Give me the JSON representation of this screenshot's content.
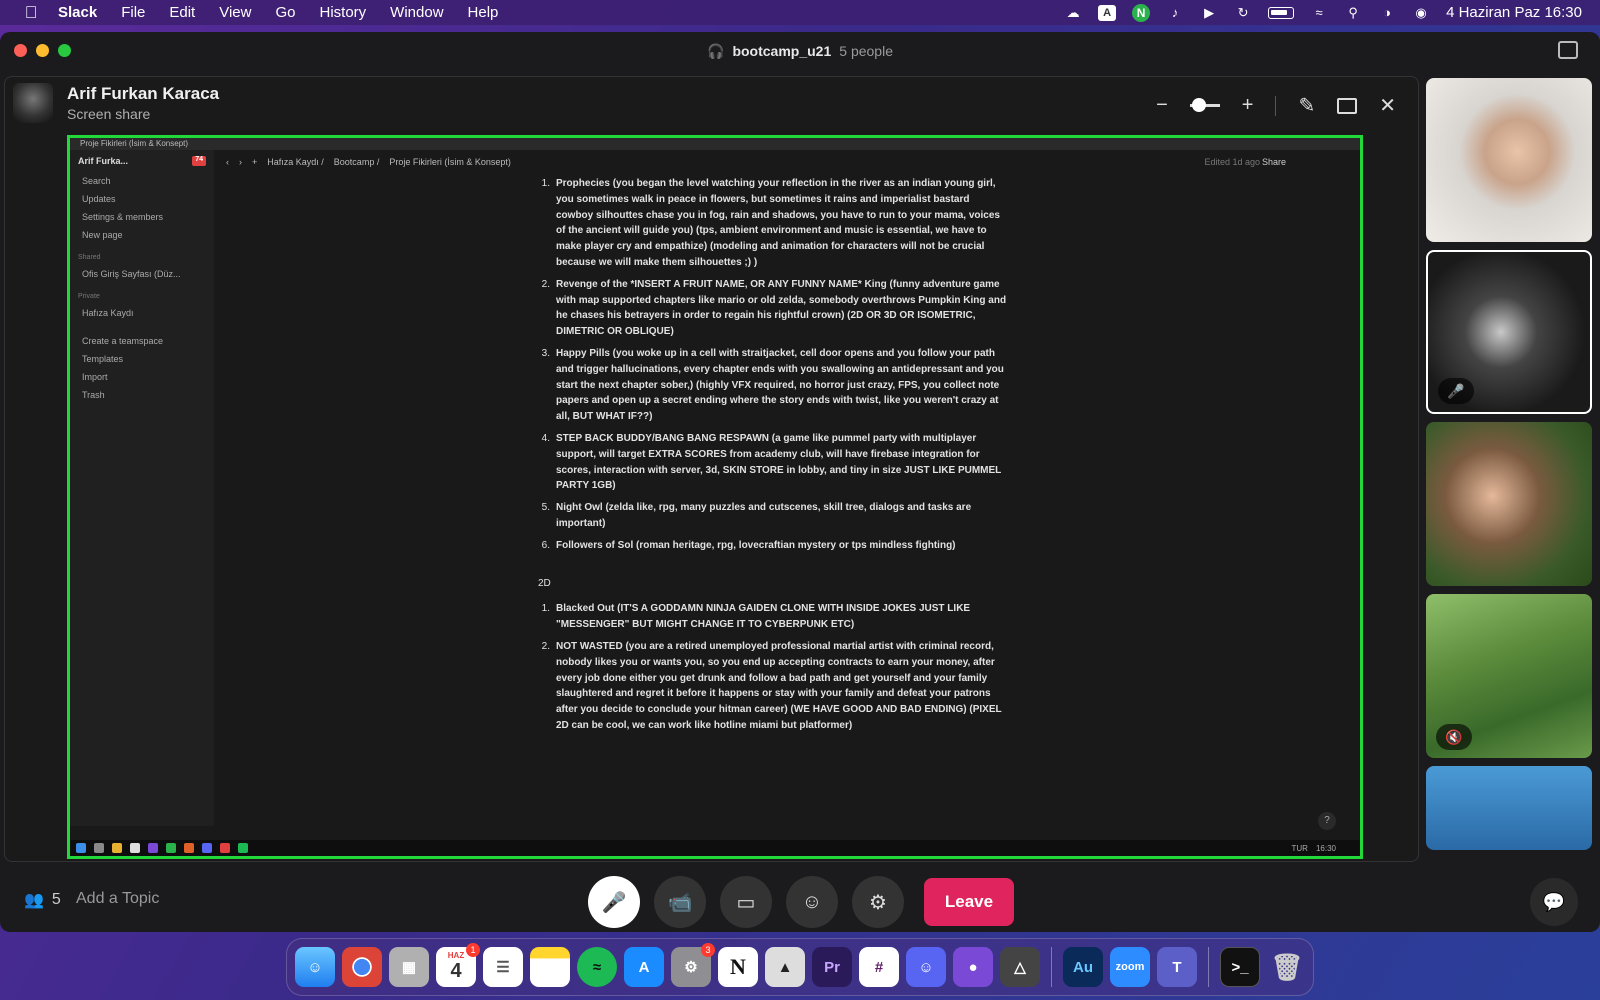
{
  "menubar": {
    "app_name": "Slack",
    "items": [
      "File",
      "Edit",
      "View",
      "Go",
      "History",
      "Window",
      "Help"
    ],
    "date_time": "4 Haziran Paz  16:30"
  },
  "window": {
    "channel": "bootcamp_u21",
    "people_count": "5 people"
  },
  "presenter": {
    "name": "Arif Furkan Karaca",
    "subtitle": "Screen share"
  },
  "shared_screen": {
    "window_title": "Proje Fikirleri (İsim & Konsept)",
    "sidebar": {
      "workspace": "Arif Furka...",
      "badge": "74",
      "items": [
        "Search",
        "Updates",
        "Settings & members",
        "New page"
      ],
      "shared_label": "Shared",
      "shared_items": [
        "Ofis Giriş Sayfası (Düz..."
      ],
      "private_label": "Private",
      "private_items": [
        "Hafıza Kaydı"
      ],
      "footer_items": [
        "Create a teamspace",
        "Templates",
        "Import",
        "Trash"
      ]
    },
    "breadcrumbs": [
      "Hafıza Kaydı /",
      "Bootcamp /",
      "Proje Fikirleri (İsim & Konsept)"
    ],
    "edited": "Edited 1d ago",
    "share_label": "Share",
    "list_3d": [
      {
        "num": "1.",
        "text": "Prophecies (you began the level watching your reflection in the river as an indian young girl, you sometimes walk in peace in flowers, but sometimes it rains and imperialist bastard cowboy silhouttes chase you in fog, rain and shadows, you have to run to your mama, voices of the ancient will guide you) (tps, ambient environment and music is essential, we have to make player cry and empathize) (modeling and animation for characters will not be crucial because we will make them silhouettes ;) )"
      },
      {
        "num": "2.",
        "text": "Revenge of the *INSERT A FRUIT NAME, OR ANY FUNNY NAME* King (funny adventure game with map supported chapters like mario or old zelda, somebody overthrows Pumpkin King and he chases his betrayers in order to regain his rightful crown) (2D OR 3D OR ISOMETRIC, DIMETRIC OR OBLIQUE)"
      },
      {
        "num": "3.",
        "text": "Happy Pills (you woke up in a cell with straitjacket, cell door opens and you follow your path and trigger hallucinations, every chapter ends with you swallowing an antidepressant and you start the next chapter sober,) (highly VFX required, no horror just crazy, FPS, you collect note papers and open up a secret ending where the story ends with twist, like you weren't crazy at all, BUT WHAT IF??)"
      },
      {
        "num": "4.",
        "text": "STEP BACK BUDDY/BANG BANG RESPAWN (a game like pummel party with multiplayer support, will target EXTRA SCORES from academy club, will have firebase integration for scores, interaction with server, 3d, SKIN STORE in lobby, and tiny in size JUST LIKE PUMMEL PARTY 1GB)"
      },
      {
        "num": "5.",
        "text": "Night Owl (zelda like, rpg, many puzzles and cutscenes, skill tree, dialogs and tasks are important)"
      },
      {
        "num": "6.",
        "text": "Followers of Sol (roman heritage, rpg, lovecraftian mystery or tps mindless fighting)"
      }
    ],
    "heading_2d": "2D",
    "list_2d": [
      {
        "num": "1.",
        "text": "Blacked Out (IT'S A GODDAMN NINJA GAIDEN CLONE WITH INSIDE JOKES JUST LIKE \"MESSENGER\" BUT MIGHT CHANGE IT TO CYBERPUNK ETC)"
      },
      {
        "num": "2.",
        "text": "NOT WASTED (you are a retired unemployed professional martial artist with criminal record, nobody likes you or wants you, so you end up accepting contracts to earn your money, after every job done either you get drunk and follow a bad path and get yourself and your family slaughtered and regret it before it happens or stay with your family and defeat your patrons after you decide to conclude your hitman career) (WE HAVE GOOD AND BAD ENDING) (PIXEL 2D can be cool, we can work like hotline miami but platformer)"
      }
    ],
    "help": "?",
    "taskbar": {
      "lang": "TUR",
      "time": "16:30"
    }
  },
  "bottom": {
    "people_count": "5",
    "topic_placeholder": "Add a Topic",
    "leave_label": "Leave"
  },
  "dock": {
    "calendar_month": "HAZ",
    "calendar_day": "4",
    "calendar_badge": "1",
    "settings_badge": "3",
    "apps": [
      "Finder",
      "Chrome",
      "Launchpad",
      "Calendar",
      "Reminders",
      "Notes",
      "Spotify",
      "App Store",
      "System Settings",
      "Notion",
      "Unity",
      "Premiere Pro",
      "Slack",
      "Discord",
      "GitHub",
      "Unity Hub",
      "Audition",
      "Zoom",
      "Teams",
      "Terminal",
      "Trash"
    ],
    "labels": {
      "notion": "N",
      "premiere": "Pr",
      "audition": "Au",
      "zoom": "zoom"
    }
  },
  "colors": {
    "share_border": "#22d83a",
    "leave": "#e0245e",
    "window_bg": "#1b1b1d"
  }
}
